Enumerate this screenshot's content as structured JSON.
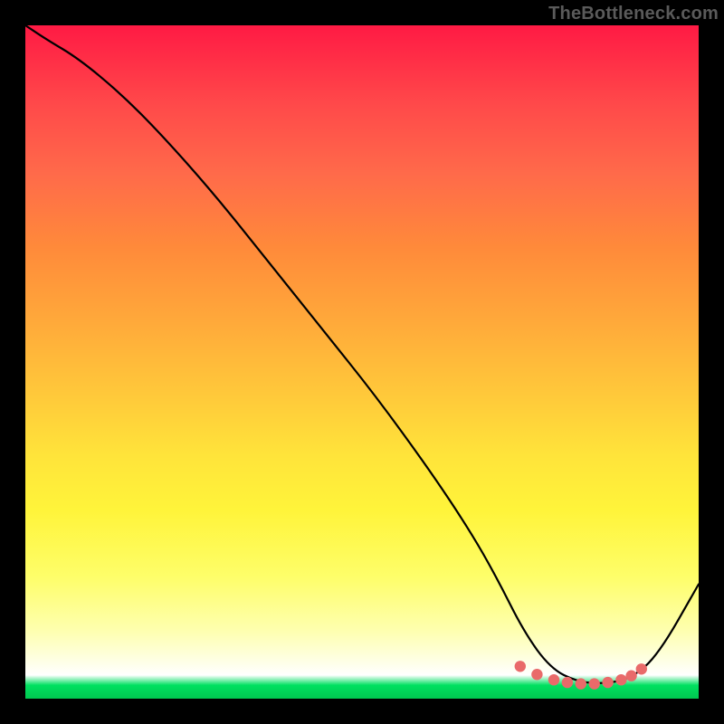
{
  "watermark": "TheBottleneck.com",
  "colors": {
    "background": "#000000",
    "curve_stroke": "#000000",
    "marker_fill": "#e96a6a",
    "marker_stroke": "#d45a5a"
  },
  "chart_data": {
    "type": "line",
    "title": "",
    "xlabel": "",
    "ylabel": "",
    "xlim": [
      0,
      100
    ],
    "ylim": [
      0,
      100
    ],
    "grid": false,
    "series": [
      {
        "name": "main-curve",
        "x": [
          0,
          3,
          8,
          14,
          20,
          28,
          36,
          44,
          52,
          60,
          66,
          70,
          74,
          78,
          82,
          86,
          90,
          94,
          100
        ],
        "y": [
          100,
          98,
          95,
          90,
          84,
          75,
          65,
          55,
          45,
          34,
          25,
          18,
          10,
          4.5,
          2.5,
          2.2,
          3.0,
          6.5,
          17
        ]
      },
      {
        "name": "valley-markers",
        "x": [
          73.5,
          76.0,
          78.5,
          80.5,
          82.5,
          84.5,
          86.5,
          88.5,
          90.0,
          91.5
        ],
        "y": [
          4.8,
          3.6,
          2.8,
          2.4,
          2.2,
          2.2,
          2.4,
          2.8,
          3.4,
          4.4
        ]
      }
    ]
  }
}
